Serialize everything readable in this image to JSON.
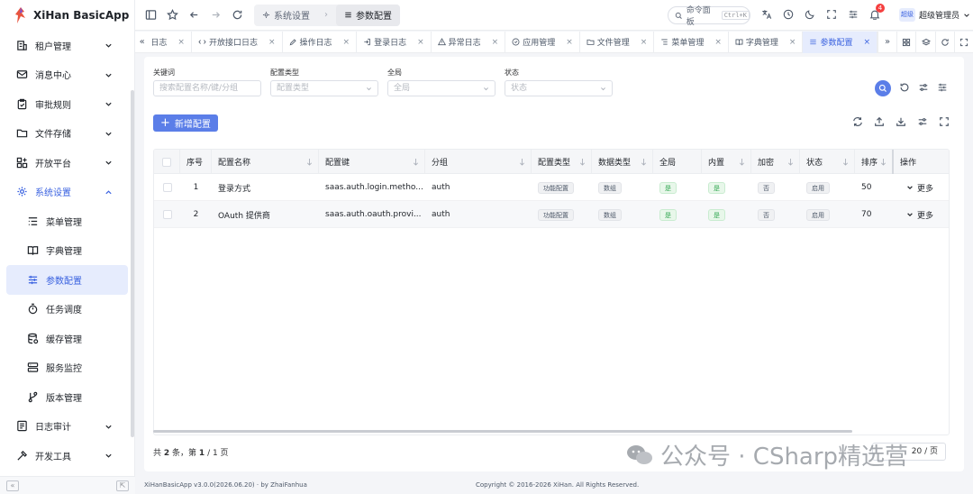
{
  "app": {
    "title": "XiHan BasicApp"
  },
  "sidebar": {
    "items": [
      {
        "label": "租户管理",
        "icon": "building-icon",
        "expandable": true
      },
      {
        "label": "消息中心",
        "icon": "mail-icon",
        "expandable": true
      },
      {
        "label": "审批规则",
        "icon": "clipboard-icon",
        "expandable": true
      },
      {
        "label": "文件存储",
        "icon": "folder-icon",
        "expandable": true
      },
      {
        "label": "开放平台",
        "icon": "grid-plus-icon",
        "expandable": true
      },
      {
        "label": "系统设置",
        "icon": "gear-icon",
        "expandable": true,
        "open": true
      },
      {
        "label": "菜单管理",
        "icon": "menu-list-icon",
        "sub": true
      },
      {
        "label": "字典管理",
        "icon": "book-icon",
        "sub": true
      },
      {
        "label": "参数配置",
        "icon": "sliders-icon",
        "sub": true,
        "active": true
      },
      {
        "label": "任务调度",
        "icon": "timer-icon",
        "sub": true
      },
      {
        "label": "缓存管理",
        "icon": "database-icon",
        "sub": true
      },
      {
        "label": "服务监控",
        "icon": "server-icon",
        "sub": true
      },
      {
        "label": "版本管理",
        "icon": "git-branch-icon",
        "sub": true
      },
      {
        "label": "日志审计",
        "icon": "log-icon",
        "expandable": true
      },
      {
        "label": "开发工具",
        "icon": "hammer-icon",
        "expandable": true
      }
    ],
    "collapse_label": "«",
    "pin_label": "⇱"
  },
  "topbar": {
    "breadcrumb": [
      "系统设置",
      "参数配置"
    ],
    "command_palette": "命令面板",
    "command_shortcut": "Ctrl+K",
    "notification_count": "4",
    "avatar_text": "超级",
    "user_name": "超级管理员"
  },
  "tabs": [
    {
      "label": "日志"
    },
    {
      "label": "开放接口日志"
    },
    {
      "label": "操作日志"
    },
    {
      "label": "登录日志"
    },
    {
      "label": "异常日志"
    },
    {
      "label": "应用管理"
    },
    {
      "label": "文件管理"
    },
    {
      "label": "菜单管理"
    },
    {
      "label": "字典管理"
    },
    {
      "label": "参数配置",
      "active": true
    }
  ],
  "tab_close": "×",
  "tab_left": "«",
  "tab_right": "»",
  "filters": [
    {
      "label": "关键词",
      "placeholder": "搜索配置名称/键/分组",
      "dropdown": false
    },
    {
      "label": "配置类型",
      "placeholder": "配置类型",
      "dropdown": true
    },
    {
      "label": "全局",
      "placeholder": "全局",
      "dropdown": true
    },
    {
      "label": "状态",
      "placeholder": "状态",
      "dropdown": true
    }
  ],
  "toolbar": {
    "add_label": "新增配置"
  },
  "table": {
    "columns": [
      "",
      "序号",
      "配置名称",
      "配置键",
      "分组",
      "配置类型",
      "数据类型",
      "全局",
      "内置",
      "加密",
      "状态",
      "排序",
      "操作"
    ],
    "rows": [
      {
        "index": "1",
        "name": "登录方式",
        "key": "saas.auth.login.metho...",
        "group": "auth",
        "config_type": "功能配置",
        "data_type": "数组",
        "global": "是",
        "builtin": "是",
        "encrypted": "否",
        "status": "启用",
        "sort": "50",
        "action": "更多"
      },
      {
        "index": "2",
        "name": "OAuth 提供商",
        "key": "saas.auth.oauth.provi...",
        "group": "auth",
        "config_type": "功能配置",
        "data_type": "数组",
        "global": "是",
        "builtin": "是",
        "encrypted": "否",
        "status": "启用",
        "sort": "70",
        "action": "更多"
      }
    ]
  },
  "pager": {
    "prefix": "共",
    "total": "2",
    "mid": "条，第",
    "page": "1",
    "suffix": "/ 1 页",
    "page_size": "20 / 页"
  },
  "footer": {
    "left": "XiHanBasicApp v3.0.0(2026.06.20) · by ZhaiFanhua",
    "middle": "Copyright © 2016-2026 XiHan. All Rights Reserved."
  },
  "watermark": "公众号 · CSharp精选营"
}
